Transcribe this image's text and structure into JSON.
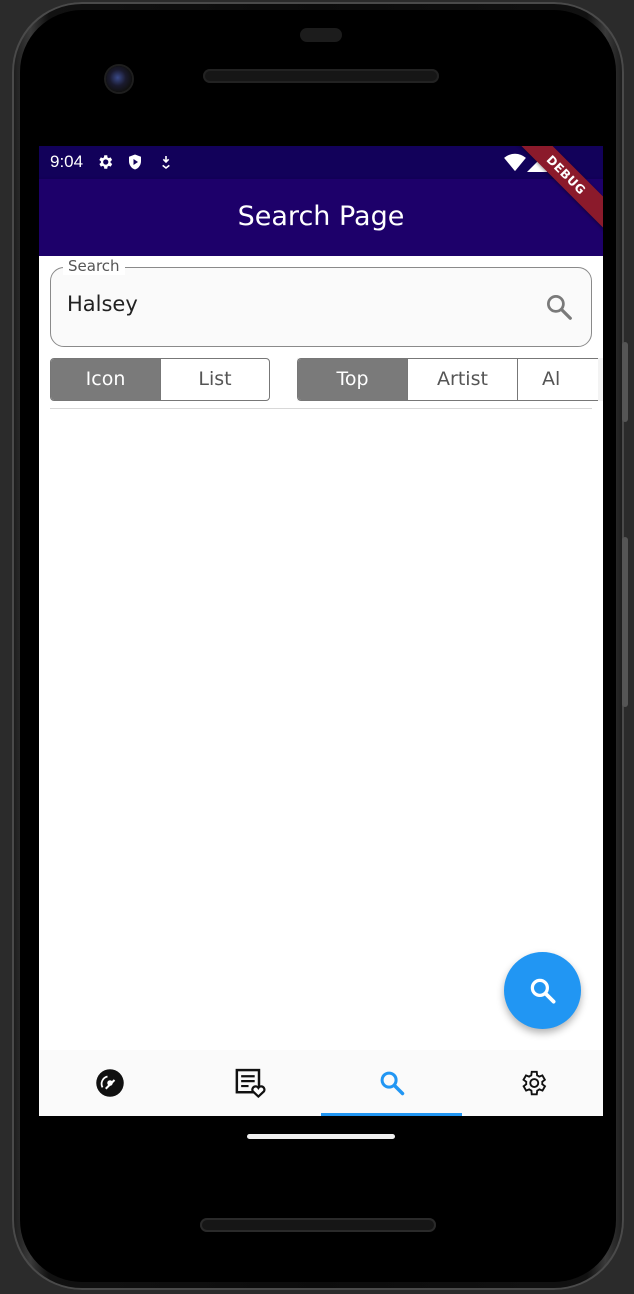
{
  "status_bar": {
    "time": "9:04",
    "left_icons": [
      "settings-icon",
      "shield-icon",
      "download-icon"
    ],
    "right_icons": [
      "wifi-icon",
      "signal-icon"
    ]
  },
  "app_bar": {
    "title": "Search Page"
  },
  "debug_banner": "DEBUG",
  "search": {
    "label": "Search",
    "value": "Halsey",
    "icon": "search-icon"
  },
  "view_toggle": {
    "options": [
      "Icon",
      "List"
    ],
    "selected": "Icon"
  },
  "filter_toggle": {
    "options": [
      "Top",
      "Artist",
      "Al"
    ],
    "selected": "Top"
  },
  "fab": {
    "icon": "search-icon",
    "color": "#2196f3"
  },
  "bottom_nav": {
    "items": [
      {
        "icon": "disc-icon"
      },
      {
        "icon": "favorite-list-icon"
      },
      {
        "icon": "search-icon"
      },
      {
        "icon": "settings-icon"
      }
    ],
    "active_index": 2
  },
  "colors": {
    "status_bar": "#12015a",
    "app_bar": "#1d006a",
    "accent": "#2196f3",
    "segment_selected": "#7a7a7a"
  }
}
